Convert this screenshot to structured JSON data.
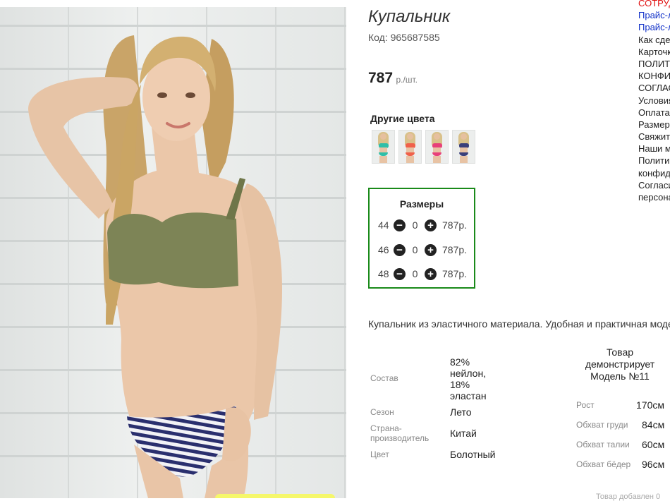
{
  "product": {
    "title": "Купальник",
    "code": "Код: 965687585",
    "price": "787",
    "price_unit": "р./шт."
  },
  "other_colors": {
    "heading": "Другие цвета",
    "swatches": [
      {
        "name": "turquoise",
        "color": "#2fbfa8"
      },
      {
        "name": "coral",
        "color": "#f0614a"
      },
      {
        "name": "pink",
        "color": "#e8407a"
      },
      {
        "name": "navy",
        "color": "#3a3f7a"
      }
    ]
  },
  "sizes": {
    "heading": "Размеры",
    "rows": [
      {
        "size": "44",
        "qty": "0",
        "price": "787р."
      },
      {
        "size": "46",
        "qty": "0",
        "price": "787р."
      },
      {
        "size": "48",
        "qty": "0",
        "price": "787р."
      }
    ]
  },
  "description": "Купальник из эластичного материала. Удобная и практичная модель",
  "specs": [
    {
      "label": "Состав",
      "value": "82%\nнейлон,\n18%\nэластан"
    },
    {
      "label": "Сезон",
      "value": "Лето"
    },
    {
      "label": "Страна-\nпроизводитель",
      "value": "Китай"
    },
    {
      "label": "Цвет",
      "value": "Болотный"
    }
  ],
  "model": {
    "heading": "Товар демонстрирует Модель №11",
    "params": [
      {
        "label": "Рост",
        "value": "170см"
      },
      {
        "label": "Обхват груди",
        "value": "84см"
      },
      {
        "label": "Обхват талии",
        "value": "60см"
      },
      {
        "label": "Обхват бёдер",
        "value": "96см"
      }
    ]
  },
  "footnote": "Товар добавлен 0",
  "side_links": [
    {
      "text": "СОТРУДНИЧЕСТВО",
      "style": "red"
    },
    {
      "text": "Прайс-лист",
      "style": "blue"
    },
    {
      "text": "Прайс-лист",
      "style": "blue"
    },
    {
      "text": "Как сделать заказ",
      "style": "txt"
    },
    {
      "text": "Карточка предприятия",
      "style": "txt"
    },
    {
      "text": "ПОЛИТИКА",
      "style": "txt"
    },
    {
      "text": "КОНФИДЕНЦИАЛЬНОСТИ",
      "style": "txt"
    },
    {
      "text": "СОГЛАСИЕ",
      "style": "txt"
    },
    {
      "text": "Условия работы",
      "style": "txt"
    },
    {
      "text": "Оплата",
      "style": "txt"
    },
    {
      "text": "Размерная сетка",
      "style": "txt"
    },
    {
      "text": "Свяжитесь с нами",
      "style": "txt"
    },
    {
      "text": "Наши магазины",
      "style": "txt"
    },
    {
      "text": "Политика",
      "style": "txt"
    },
    {
      "text": "конфиденциальности",
      "style": "txt"
    },
    {
      "text": "Согласие на обработку",
      "style": "txt"
    },
    {
      "text": "персональных данных",
      "style": "txt"
    }
  ],
  "colors": {
    "sizes_border": "#1a8a1a",
    "link_red": "#e01010",
    "link_blue": "#1030c8",
    "swimsuit_top": "#7d8456"
  }
}
